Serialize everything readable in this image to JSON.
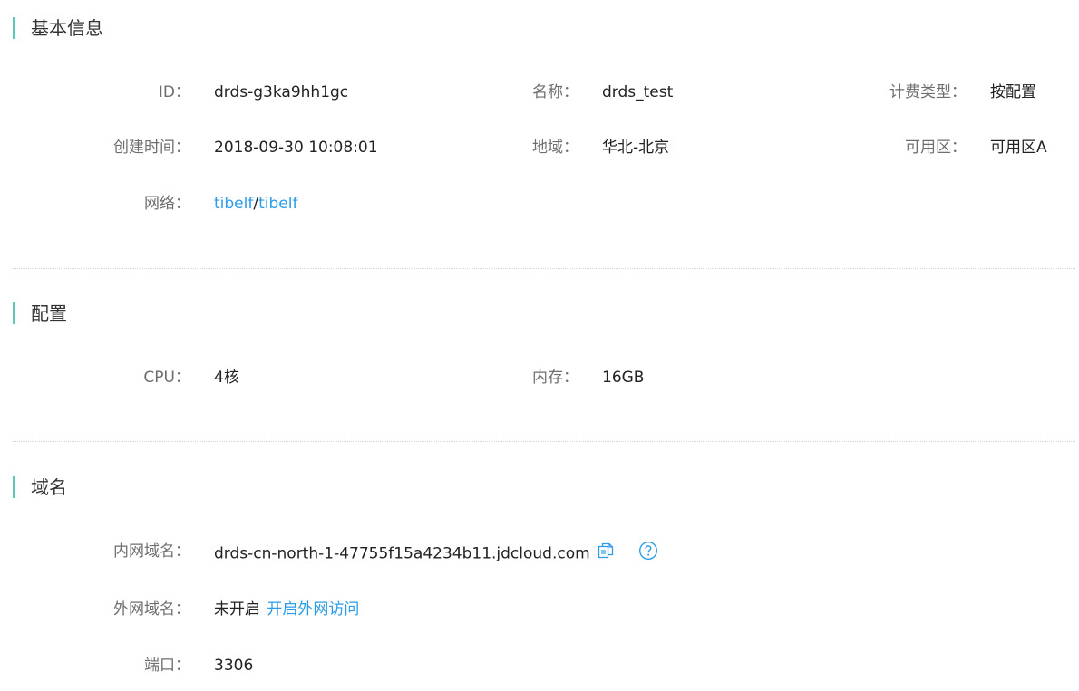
{
  "colors": {
    "accent": "#5ac8b4",
    "link": "#2d9ce8",
    "label": "#6e6e6e",
    "value": "#222222"
  },
  "basic_info": {
    "title": "基本信息",
    "id_label": "ID：",
    "id_value": "drds-g3ka9hh1gc",
    "name_label": "名称：",
    "name_value": "drds_test",
    "billing_label": "计费类型：",
    "billing_value": "按配置",
    "created_label": "创建时间：",
    "created_value": "2018-09-30 10:08:01",
    "region_label": "地域：",
    "region_value": "华北-北京",
    "az_label": "可用区：",
    "az_value": "可用区A",
    "network_label": "网络：",
    "vpc_link": "tibelf",
    "network_sep": "/",
    "subnet_link": "tibelf"
  },
  "config": {
    "title": "配置",
    "cpu_label": "CPU：",
    "cpu_value": "4核",
    "memory_label": "内存：",
    "memory_value": "16GB"
  },
  "domain": {
    "title": "域名",
    "internal_label": "内网域名：",
    "internal_value": "drds-cn-north-1-47755f15a4234b11.jdcloud.com",
    "copy_icon": "copy-icon",
    "help_icon": "help-icon",
    "external_label": "外网域名：",
    "external_status": "未开启",
    "external_link": "开启外网访问",
    "port_label": "端口：",
    "port_value": "3306"
  }
}
